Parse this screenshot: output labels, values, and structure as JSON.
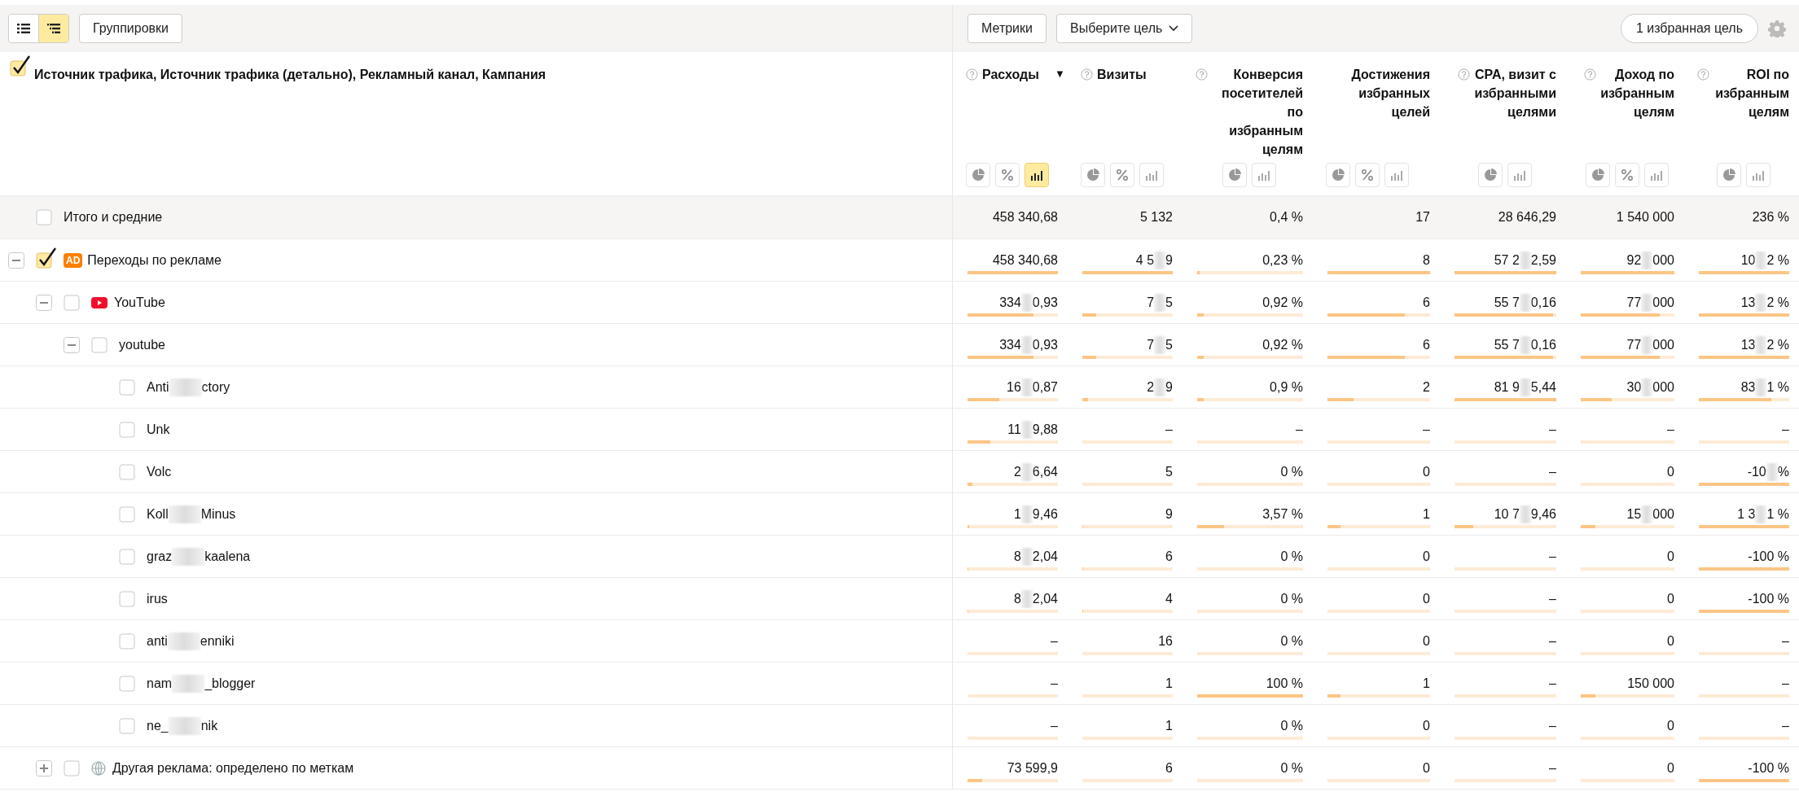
{
  "toolbar": {
    "view_buttons": [
      {
        "kind": "list",
        "selected": false
      },
      {
        "kind": "tree",
        "selected": true
      }
    ],
    "groupings_button": "Группировки",
    "metrics_button": "Метрики",
    "goal_select": {
      "value": "Выберите цель"
    },
    "favorite_goals_button": "1 избранная цель"
  },
  "table": {
    "dimension_header": {
      "checked": true,
      "title": "Источник трафика, Источник трафика (детально), Рекламный канал, Кампания"
    },
    "columns": [
      {
        "title": "Расходы",
        "help": true,
        "sort": "▼",
        "views": [
          {
            "kind": "pie",
            "selected": false
          },
          {
            "kind": "percent",
            "selected": false
          },
          {
            "kind": "bars",
            "selected": true
          }
        ]
      },
      {
        "title": "Визиты",
        "help": true,
        "views": [
          {
            "kind": "pie",
            "selected": false
          },
          {
            "kind": "percent",
            "selected": false
          },
          {
            "kind": "bars",
            "selected": false
          }
        ]
      },
      {
        "title": "Конверсия посетителей по избранным целям",
        "help": true,
        "views": [
          {
            "kind": "pie",
            "selected": false
          },
          {
            "kind": "bars",
            "selected": false
          }
        ]
      },
      {
        "title": "Достижения избранных целей",
        "help": false,
        "views": [
          {
            "kind": "pie",
            "selected": false
          },
          {
            "kind": "percent",
            "selected": false
          },
          {
            "kind": "bars",
            "selected": false
          }
        ]
      },
      {
        "title": "CPA, визит с избранными целями",
        "help": true,
        "views": [
          {
            "kind": "pie",
            "selected": false
          },
          {
            "kind": "bars",
            "selected": false
          }
        ]
      },
      {
        "title": "Доход по избранным целям",
        "help": true,
        "views": [
          {
            "kind": "pie",
            "selected": false
          },
          {
            "kind": "percent",
            "selected": false
          },
          {
            "kind": "bars",
            "selected": false
          }
        ]
      },
      {
        "title": "ROI по избранным целям",
        "help": true,
        "views": [
          {
            "kind": "pie",
            "selected": false
          },
          {
            "kind": "bars",
            "selected": false
          }
        ]
      }
    ],
    "totals": {
      "checked": false,
      "label": "Итого и средние",
      "cells": [
        "458 340,68",
        "5 132",
        "0,4 %",
        "17",
        "28 646,29",
        "1 540 000",
        "236 %"
      ]
    },
    "rows": [
      {
        "label_parts": [
          "Переходы по рекламе"
        ],
        "icon": {
          "kind": "badge",
          "text": "AD"
        },
        "checked": true,
        "expanded": true,
        "cells": [
          {
            "parts": [
              "458 340,68"
            ],
            "level": 1
          },
          {
            "parts": [
              "4 5",
              "9"
            ],
            "level": 1
          },
          {
            "parts": [
              "0,23 %"
            ],
            "level": 0.02
          },
          {
            "parts": [
              "8"
            ],
            "level": 1
          },
          {
            "parts": [
              "57 2",
              "2,59"
            ],
            "level": 1
          },
          {
            "parts": [
              "92",
              "000"
            ],
            "level": 1
          },
          {
            "parts": [
              "10",
              "2 %"
            ],
            "level": 1
          }
        ],
        "children": [
          {
            "label_parts": [
              "YouTube"
            ],
            "icon": {
              "kind": "youtube"
            },
            "checked": false,
            "expanded": true,
            "cells": [
              {
                "parts": [
                  "334",
                  "0,93"
                ],
                "level": 0.73
              },
              {
                "parts": [
                  "7",
                  "5"
                ],
                "level": 0.15
              },
              {
                "parts": [
                  "0,92 %"
                ],
                "level": 0.06
              },
              {
                "parts": [
                  "6"
                ],
                "level": 0.75
              },
              {
                "parts": [
                  "55 7",
                  "0,16"
                ],
                "level": 0.97
              },
              {
                "parts": [
                  "77",
                  "000"
                ],
                "level": 0.84
              },
              {
                "parts": [
                  "13",
                  "2 %"
                ],
                "level": 1
              }
            ],
            "children": [
              {
                "label_parts": [
                  "youtube"
                ],
                "checked": false,
                "expanded": true,
                "cells": [
                  {
                    "parts": [
                      "334",
                      "0,93"
                    ],
                    "level": 0.73
                  },
                  {
                    "parts": [
                      "7",
                      "5"
                    ],
                    "level": 0.15
                  },
                  {
                    "parts": [
                      "0,92 %"
                    ],
                    "level": 0.06
                  },
                  {
                    "parts": [
                      "6"
                    ],
                    "level": 0.75
                  },
                  {
                    "parts": [
                      "55 7",
                      "0,16"
                    ],
                    "level": 0.97
                  },
                  {
                    "parts": [
                      "77",
                      "000"
                    ],
                    "level": 0.84
                  },
                  {
                    "parts": [
                      "13",
                      "2 %"
                    ],
                    "level": 1
                  }
                ],
                "children": [
                  {
                    "label_parts": [
                      "Anti",
                      "ctory"
                    ],
                    "checked": false,
                    "cells": [
                      {
                        "parts": [
                          "16",
                          "0,87"
                        ],
                        "level": 0.35
                      },
                      {
                        "parts": [
                          "2",
                          "9"
                        ],
                        "level": 0.06
                      },
                      {
                        "parts": [
                          "0,9 %"
                        ],
                        "level": 0.06
                      },
                      {
                        "parts": [
                          "2"
                        ],
                        "level": 0.25
                      },
                      {
                        "parts": [
                          "81 9",
                          "5,44"
                        ],
                        "level": 1
                      },
                      {
                        "parts": [
                          "30",
                          "000"
                        ],
                        "level": 0.33
                      },
                      {
                        "parts": [
                          "83",
                          "1 %"
                        ],
                        "level": 0.8
                      }
                    ]
                  },
                  {
                    "label_parts": [
                      "Unk"
                    ],
                    "checked": false,
                    "cells": [
                      {
                        "parts": [
                          "11",
                          "9,88"
                        ],
                        "level": 0.25
                      },
                      {
                        "parts": [
                          "–"
                        ],
                        "level": 0
                      },
                      {
                        "parts": [
                          "–"
                        ],
                        "level": 0
                      },
                      {
                        "parts": [
                          "–"
                        ],
                        "level": 0
                      },
                      {
                        "parts": [
                          "–"
                        ],
                        "level": 0
                      },
                      {
                        "parts": [
                          "–"
                        ],
                        "level": 0
                      },
                      {
                        "parts": [
                          "–"
                        ],
                        "level": 0
                      }
                    ]
                  },
                  {
                    "label_parts": [
                      "Volc"
                    ],
                    "checked": false,
                    "cells": [
                      {
                        "parts": [
                          "2",
                          "6,64"
                        ],
                        "level": 0.05
                      },
                      {
                        "parts": [
                          "5"
                        ],
                        "level": 0
                      },
                      {
                        "parts": [
                          "0 %"
                        ],
                        "level": 0
                      },
                      {
                        "parts": [
                          "0"
                        ],
                        "level": 0
                      },
                      {
                        "parts": [
                          "–"
                        ],
                        "level": 0
                      },
                      {
                        "parts": [
                          "0"
                        ],
                        "level": 0
                      },
                      {
                        "parts": [
                          "-10",
                          "%"
                        ],
                        "level": 1
                      }
                    ]
                  },
                  {
                    "label_parts": [
                      "Koll",
                      "Minus"
                    ],
                    "checked": false,
                    "cells": [
                      {
                        "parts": [
                          "1",
                          "9,46"
                        ],
                        "level": 0.02
                      },
                      {
                        "parts": [
                          "9"
                        ],
                        "level": 0.01
                      },
                      {
                        "parts": [
                          "3,57 %"
                        ],
                        "level": 0.25
                      },
                      {
                        "parts": [
                          "1"
                        ],
                        "level": 0.13
                      },
                      {
                        "parts": [
                          "10 7",
                          "9,46"
                        ],
                        "level": 0.18
                      },
                      {
                        "parts": [
                          "15",
                          "000"
                        ],
                        "level": 0.16
                      },
                      {
                        "parts": [
                          "1 3",
                          "1 %"
                        ],
                        "level": 1
                      }
                    ]
                  },
                  {
                    "label_parts": [
                      "graz",
                      "kaalena"
                    ],
                    "checked": false,
                    "cells": [
                      {
                        "parts": [
                          "8",
                          "2,04"
                        ],
                        "level": 0.01
                      },
                      {
                        "parts": [
                          "6"
                        ],
                        "level": 0.01
                      },
                      {
                        "parts": [
                          "0 %"
                        ],
                        "level": 0
                      },
                      {
                        "parts": [
                          "0"
                        ],
                        "level": 0
                      },
                      {
                        "parts": [
                          "–"
                        ],
                        "level": 0
                      },
                      {
                        "parts": [
                          "0"
                        ],
                        "level": 0
                      },
                      {
                        "parts": [
                          "-100 %"
                        ],
                        "level": 1
                      }
                    ]
                  },
                  {
                    "label_parts": [
                      "irus"
                    ],
                    "checked": false,
                    "cells": [
                      {
                        "parts": [
                          "8",
                          "2,04"
                        ],
                        "level": 0.01
                      },
                      {
                        "parts": [
                          "4"
                        ],
                        "level": 0.01
                      },
                      {
                        "parts": [
                          "0 %"
                        ],
                        "level": 0
                      },
                      {
                        "parts": [
                          "0"
                        ],
                        "level": 0
                      },
                      {
                        "parts": [
                          "–"
                        ],
                        "level": 0
                      },
                      {
                        "parts": [
                          "0"
                        ],
                        "level": 0
                      },
                      {
                        "parts": [
                          "-100 %"
                        ],
                        "level": 1
                      }
                    ]
                  },
                  {
                    "label_parts": [
                      "anti",
                      "enniki"
                    ],
                    "checked": false,
                    "cells": [
                      {
                        "parts": [
                          "–"
                        ],
                        "level": 0
                      },
                      {
                        "parts": [
                          "16"
                        ],
                        "level": 0
                      },
                      {
                        "parts": [
                          "0 %"
                        ],
                        "level": 0
                      },
                      {
                        "parts": [
                          "0"
                        ],
                        "level": 0
                      },
                      {
                        "parts": [
                          "–"
                        ],
                        "level": 0
                      },
                      {
                        "parts": [
                          "0"
                        ],
                        "level": 0
                      },
                      {
                        "parts": [
                          "–"
                        ],
                        "level": 0
                      }
                    ]
                  },
                  {
                    "label_parts": [
                      "nam",
                      "_blogger"
                    ],
                    "checked": false,
                    "cells": [
                      {
                        "parts": [
                          "–"
                        ],
                        "level": 0
                      },
                      {
                        "parts": [
                          "1"
                        ],
                        "level": 0
                      },
                      {
                        "parts": [
                          "100 %"
                        ],
                        "level": 1
                      },
                      {
                        "parts": [
                          "1"
                        ],
                        "level": 0.13
                      },
                      {
                        "parts": [
                          "–"
                        ],
                        "level": 0
                      },
                      {
                        "parts": [
                          "150 000"
                        ],
                        "level": 0.16
                      },
                      {
                        "parts": [
                          "–"
                        ],
                        "level": 0
                      }
                    ]
                  },
                  {
                    "label_parts": [
                      "ne_",
                      "nik"
                    ],
                    "checked": false,
                    "cells": [
                      {
                        "parts": [
                          "–"
                        ],
                        "level": 0
                      },
                      {
                        "parts": [
                          "1"
                        ],
                        "level": 0
                      },
                      {
                        "parts": [
                          "0 %"
                        ],
                        "level": 0
                      },
                      {
                        "parts": [
                          "0"
                        ],
                        "level": 0
                      },
                      {
                        "parts": [
                          "–"
                        ],
                        "level": 0
                      },
                      {
                        "parts": [
                          "0"
                        ],
                        "level": 0
                      },
                      {
                        "parts": [
                          "–"
                        ],
                        "level": 0
                      }
                    ]
                  }
                ]
              }
            ]
          },
          {
            "label_parts": [
              "Другая реклама: определено по меткам"
            ],
            "icon": {
              "kind": "globe"
            },
            "checked": false,
            "expanded": false,
            "cells": [
              {
                "parts": [
                  "73 599,9"
                ],
                "level": 0.16
              },
              {
                "parts": [
                  "6"
                ],
                "level": 0
              },
              {
                "parts": [
                  "0 %"
                ],
                "level": 0
              },
              {
                "parts": [
                  "0"
                ],
                "level": 0
              },
              {
                "parts": [
                  "–"
                ],
                "level": 0
              },
              {
                "parts": [
                  "0"
                ],
                "level": 0
              },
              {
                "parts": [
                  "-100 %"
                ],
                "level": 1
              }
            ]
          }
        ]
      }
    ]
  }
}
